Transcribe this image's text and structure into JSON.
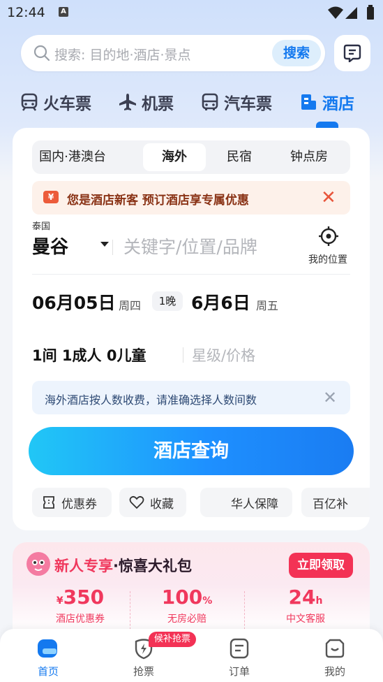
{
  "status_bar": {
    "time": "12:44",
    "notification_icon": "A"
  },
  "search": {
    "placeholder": "搜索: 目的地·酒店·景点",
    "button_label": "搜索"
  },
  "transport_tabs": [
    {
      "label": "火车票",
      "icon": "train-icon"
    },
    {
      "label": "机票",
      "icon": "plane-icon"
    },
    {
      "label": "汽车票",
      "icon": "bus-icon"
    },
    {
      "label": "酒店",
      "icon": "hotel-icon",
      "active": true
    }
  ],
  "hotel_form": {
    "segments": [
      "国内·港澳台",
      "海外",
      "民宿",
      "钟点房"
    ],
    "selected_segment": "海外",
    "promo": {
      "icon_text": "¥",
      "text": "您是酒店新客 预订酒店享专属优惠"
    },
    "country": "泰国",
    "city": "曼谷",
    "keyword_placeholder": "关键字/位置/品牌",
    "my_location": "我的位置",
    "checkin_date": "06月05日",
    "checkin_weekday": "周四",
    "nights": "1晚",
    "checkout_date": "6月6日",
    "checkout_weekday": "周五",
    "guests": "1间 1成人 0儿童",
    "star_price_placeholder": "星级/价格",
    "notice": "海外酒店按人数收费，请准确选择人数间数",
    "search_button": "酒店查询",
    "chips": [
      {
        "label": "优惠券",
        "icon": "coupon-icon"
      },
      {
        "label": "收藏",
        "icon": "heart-icon"
      },
      {
        "label": "华人保障",
        "icon": ""
      },
      {
        "label": "百亿补",
        "icon": ""
      }
    ]
  },
  "new_user_banner": {
    "title_highlight": "新人专享",
    "title_rest": "·惊喜大礼包",
    "claim_button": "立即领取",
    "perks": [
      {
        "value": "350",
        "prefix": "¥",
        "suffix": "",
        "label": "酒店优惠券"
      },
      {
        "value": "100",
        "prefix": "",
        "suffix": "%",
        "label": "无房必赔"
      },
      {
        "value": "24",
        "prefix": "",
        "suffix": "h",
        "label": "中文客服"
      }
    ]
  },
  "bottom_nav": {
    "items": [
      {
        "label": "首页",
        "icon": "home-icon",
        "active": true
      },
      {
        "label": "抢票",
        "icon": "ticket-grab-icon"
      },
      {
        "label": "订单",
        "icon": "orders-icon"
      },
      {
        "label": "我的",
        "icon": "profile-icon"
      }
    ],
    "badge": "候补抢票"
  },
  "colors": {
    "accent": "#1479ef",
    "promo_red": "#f33255",
    "text_dark": "#111111"
  }
}
